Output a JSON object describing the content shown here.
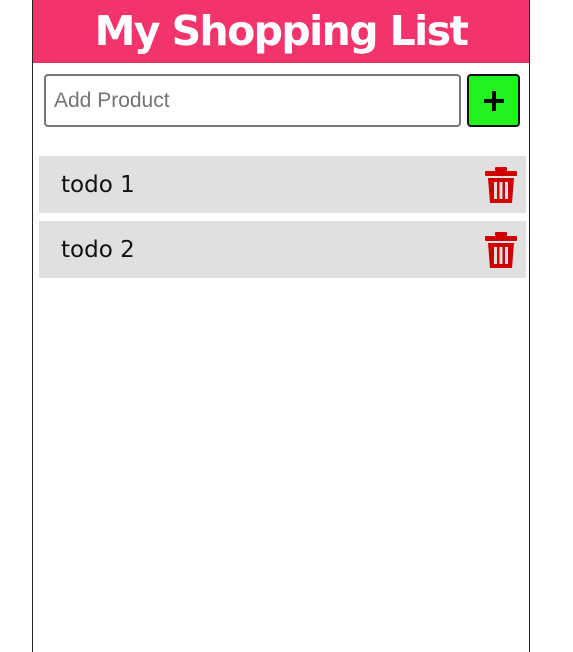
{
  "header": {
    "title": "My Shopping List",
    "background_color": "#f3336c",
    "text_color": "#ffffff"
  },
  "add_form": {
    "input_value": "",
    "input_placeholder": "Add Product",
    "add_button_icon": "plus-icon",
    "add_button_color": "#1ff21f"
  },
  "items": [
    {
      "label": "todo 1",
      "delete_icon": "trash-icon"
    },
    {
      "label": "todo 2",
      "delete_icon": "trash-icon"
    }
  ],
  "colors": {
    "item_background": "#e1dfe0",
    "delete_icon": "#d10000"
  }
}
